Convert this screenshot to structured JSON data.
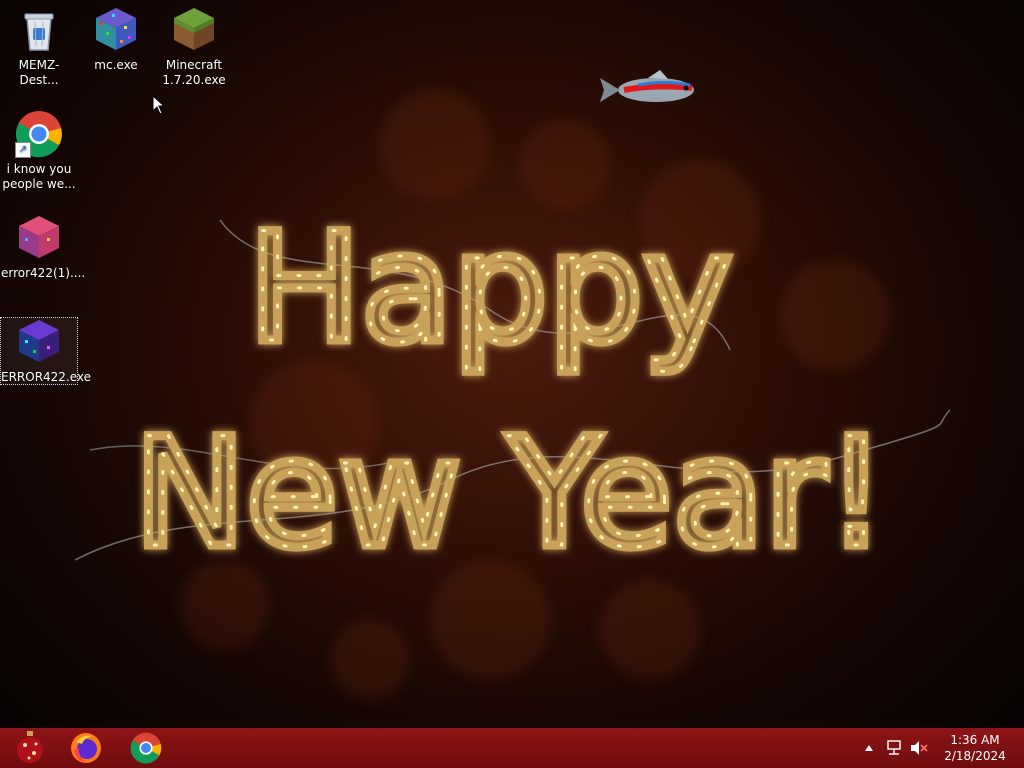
{
  "desktop": {
    "icons": [
      {
        "label": "MEMZ-Dest...",
        "icon": "recycle-bin-icon"
      },
      {
        "label": "mc.exe",
        "icon": "noise-cube-icon"
      },
      {
        "label": "Minecraft\n1.7.20.exe",
        "icon": "grass-block-icon"
      },
      {
        "label": "i know you\npeople we...",
        "icon": "chrome-shortcut-icon"
      },
      {
        "label": "error422(1)....",
        "icon": "pink-cube-icon"
      },
      {
        "label": "ERROR422.exe",
        "icon": "purple-cube-icon"
      }
    ]
  },
  "wallpaper": {
    "line1": "Happy",
    "line2": "New Year!",
    "colors": {
      "glow": "#f5c84a",
      "tube": "#c9a25a",
      "background": "#2e0f06"
    }
  },
  "taskbar": {
    "color": "#7e1012",
    "pinned": [
      "ornament-icon",
      "firefox-icon",
      "chrome-icon"
    ],
    "tray": {
      "icons": [
        "chevron-up-icon",
        "network-icon",
        "volume-muted-icon"
      ],
      "time": "1:36 AM",
      "date": "2/18/2024"
    }
  }
}
